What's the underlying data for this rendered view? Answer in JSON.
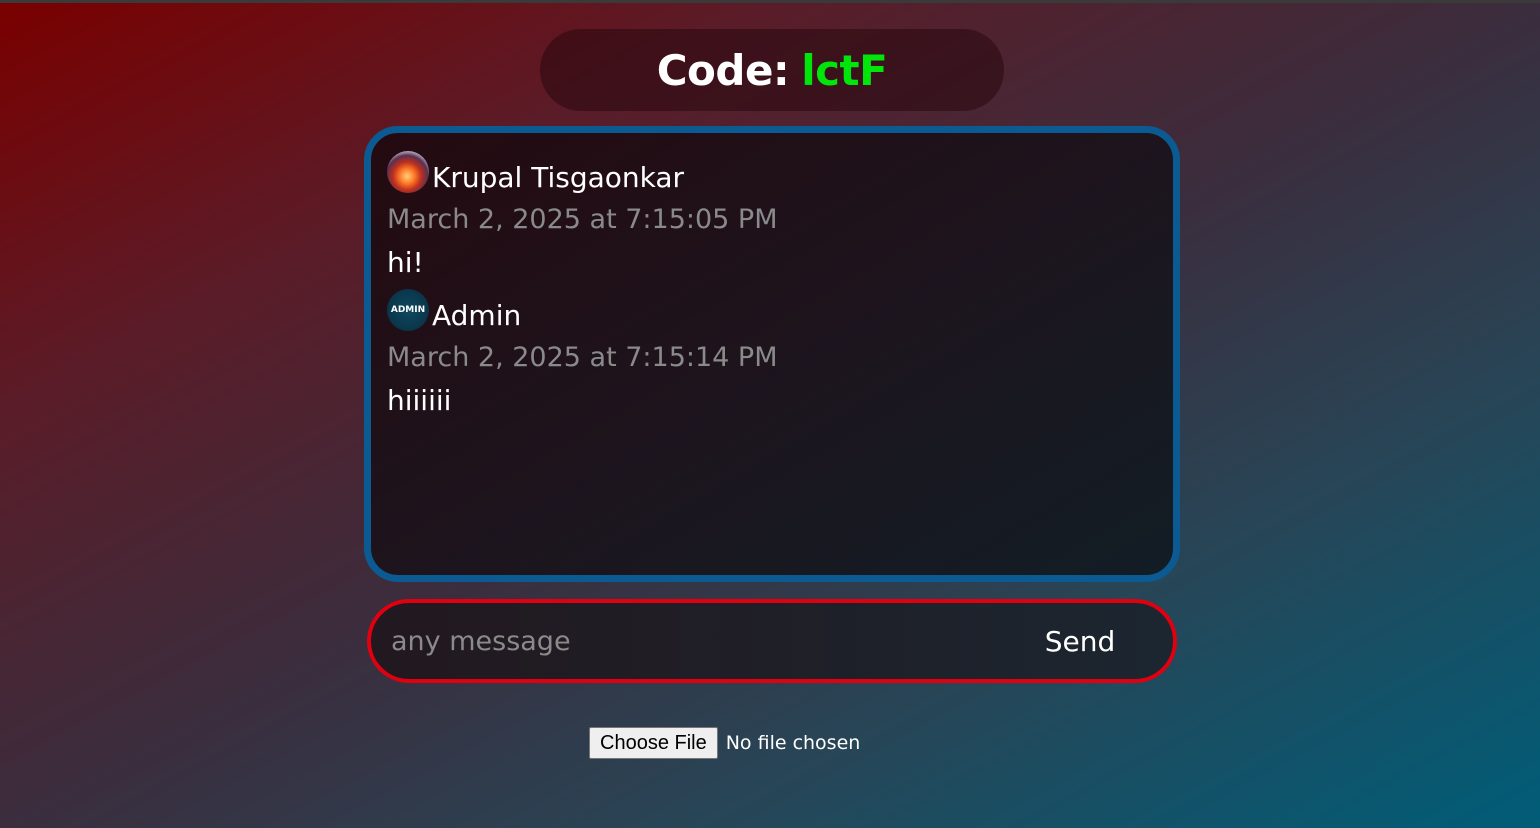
{
  "header": {
    "code_label": "Code:",
    "code_value": "lctF"
  },
  "messages": [
    {
      "avatar": "profile-photo",
      "username": "Krupal Tisgaonkar",
      "timestamp": "March 2, 2025 at 7:15:05 PM",
      "text": "hi!"
    },
    {
      "avatar": "admin-badge",
      "avatar_text": "ADMIN",
      "username": "Admin",
      "timestamp": "March 2, 2025 at 7:15:14 PM",
      "text": "hiiiiii"
    }
  ],
  "composer": {
    "placeholder": "any message",
    "value": "",
    "send_label": "Send"
  },
  "file_upload": {
    "button_label": "Choose File",
    "status": "No file chosen"
  },
  "colors": {
    "code_accent": "#00e60a",
    "chat_border": "#0b5a92",
    "input_border": "#e00010",
    "timestamp_text": "#8a8a8a"
  }
}
